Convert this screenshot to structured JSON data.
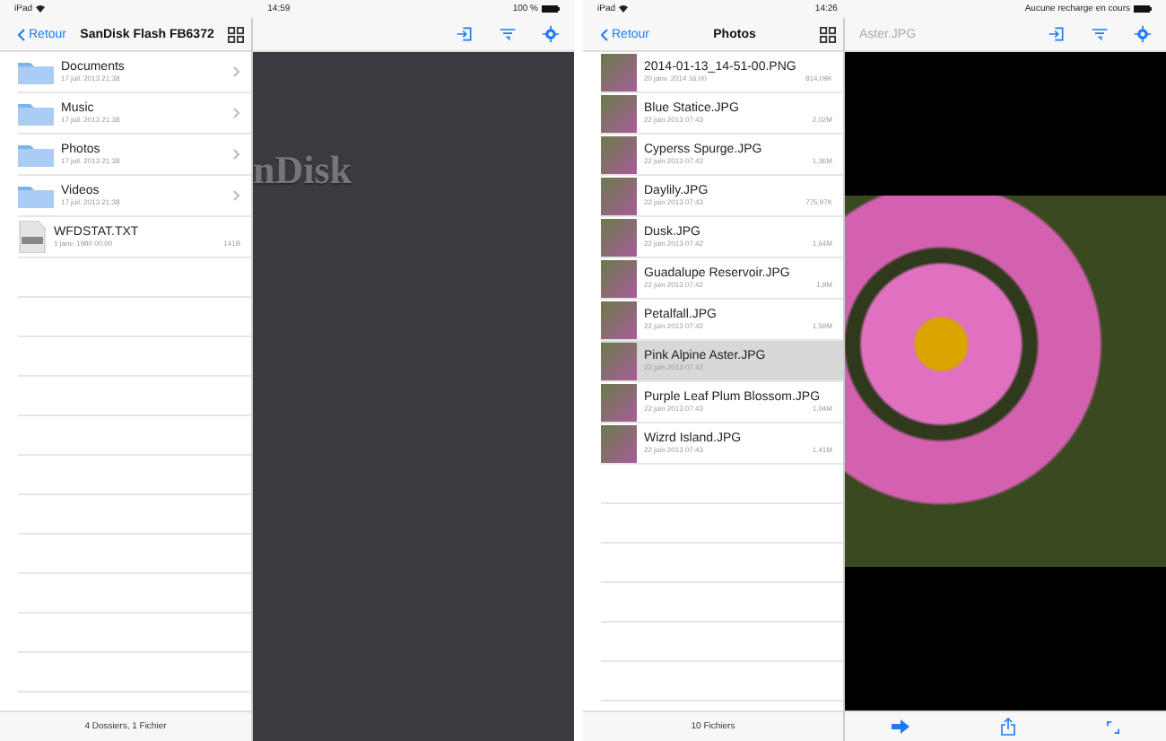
{
  "screens": [
    {
      "status_bar": {
        "device": "iPad",
        "time": "14:59",
        "battery": "100 %"
      },
      "nav": {
        "back": "Retour",
        "title": "SanDisk Flash FB6372"
      },
      "items": [
        {
          "kind": "folder",
          "name": "Documents",
          "date": "17 juil. 2013 21:38",
          "selected": false
        },
        {
          "kind": "folder",
          "name": "Music",
          "date": "17 juil. 2013 21:38",
          "selected": false
        },
        {
          "kind": "folder",
          "name": "Photos",
          "date": "17 juil. 2013 21:38",
          "selected": false
        },
        {
          "kind": "folder",
          "name": "Videos",
          "date": "17 juil. 2013 21:38",
          "selected": false
        },
        {
          "kind": "text",
          "name": "WFDSTAT.TXT",
          "date": "1 janv. 1980 00:00",
          "size": "141B",
          "selected": false
        }
      ],
      "footer": "4 Dossiers, 1 Fichier",
      "detail": {
        "kind": "empty",
        "logo_text": "nDisk"
      }
    },
    {
      "status_bar": {
        "device": "iPad",
        "time": "14:26",
        "battery": "Aucune recharge en cours"
      },
      "nav": {
        "back": "Retour",
        "title": "Photos"
      },
      "items": [
        {
          "kind": "image",
          "name": "2014-01-13_14-51-00.PNG",
          "date": "20 janv. 2014 16:00",
          "size": "814,09K",
          "selected": false
        },
        {
          "kind": "image",
          "name": "Blue Statice.JPG",
          "date": "22 juin 2013 07:43",
          "size": "2,02M",
          "selected": false
        },
        {
          "kind": "image",
          "name": "Cyperss Spurge.JPG",
          "date": "22 juin 2013 07:42",
          "size": "1,36M",
          "selected": false
        },
        {
          "kind": "image",
          "name": "Daylily.JPG",
          "date": "22 juin 2013 07:43",
          "size": "775,97K",
          "selected": false
        },
        {
          "kind": "image",
          "name": "Dusk.JPG",
          "date": "22 juin 2013 07:42",
          "size": "1,64M",
          "selected": false
        },
        {
          "kind": "image",
          "name": "Guadalupe Reservoir.JPG",
          "date": "22 juin 2013 07:42",
          "size": "1,9M",
          "selected": false
        },
        {
          "kind": "image",
          "name": "Petalfall.JPG",
          "date": "22 juin 2013 07:42",
          "size": "1,59M",
          "selected": false
        },
        {
          "kind": "image",
          "name": "Pink Alpine Aster.JPG",
          "date": "22 juin 2013 07:43",
          "selected": true
        },
        {
          "kind": "image",
          "name": "Purple Leaf Plum Blossom.JPG",
          "date": "22 juin 2013 07:43",
          "size": "1,04M",
          "selected": false
        },
        {
          "kind": "image",
          "name": "Wizrd Island.JPG",
          "date": "22 juin 2013 07:43",
          "size": "1,41M",
          "selected": false
        }
      ],
      "footer": "10 Fichiers",
      "detail": {
        "kind": "photo",
        "title": "Aster.JPG"
      }
    }
  ]
}
